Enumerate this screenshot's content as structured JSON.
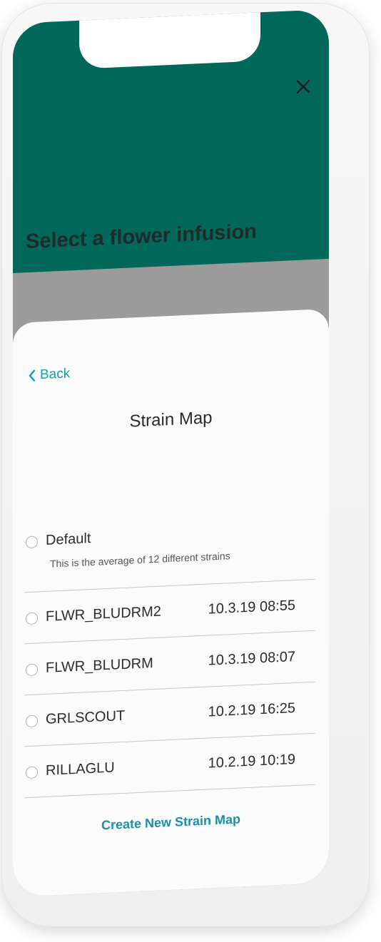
{
  "header": {
    "title": "Select a flower infusion",
    "close_icon": "close-icon",
    "background_color": "#02685a"
  },
  "sheet": {
    "back_label": "Back",
    "back_icon": "chevron-left-icon",
    "title": "Strain Map",
    "accent_color": "#1b9aaa",
    "default_option": {
      "label": "Default",
      "description": "This is the average of 12 different strains"
    },
    "strain_maps": [
      {
        "name": "FLWR_BLUDRM2",
        "date": "10.3.19 08:55"
      },
      {
        "name": "FLWR_BLUDRM",
        "date": "10.3.19 08:07"
      },
      {
        "name": "GRLSCOUT",
        "date": "10.2.19 16:25"
      },
      {
        "name": "RILLAGLU",
        "date": "10.2.19 10:19"
      }
    ],
    "create_label": "Create New Strain Map"
  }
}
